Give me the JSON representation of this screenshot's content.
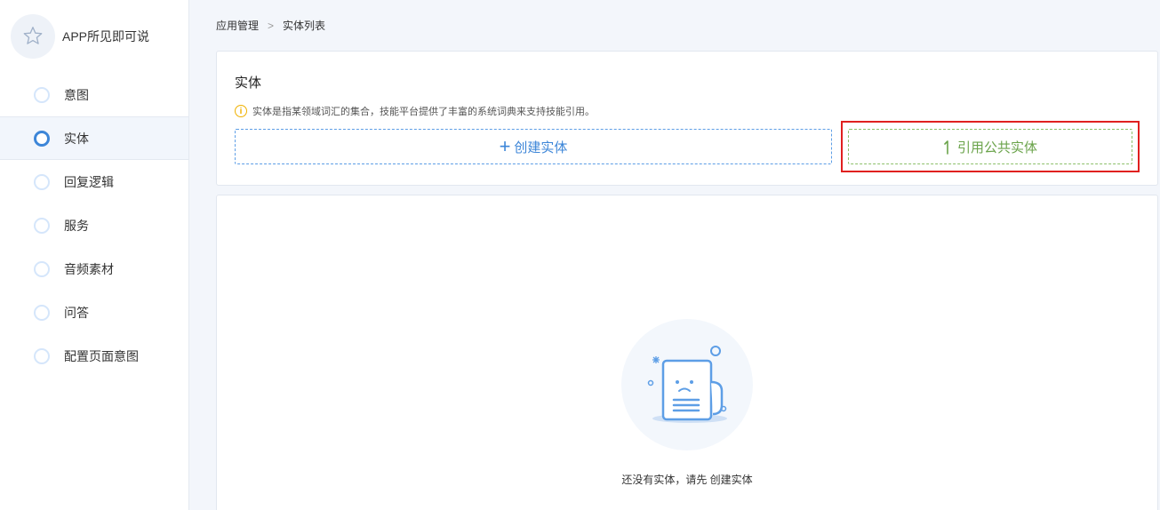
{
  "app": {
    "name": "APP所见即可说"
  },
  "sidebar": {
    "items": [
      {
        "label": "意图",
        "active": false
      },
      {
        "label": "实体",
        "active": true
      },
      {
        "label": "回复逻辑",
        "active": false
      },
      {
        "label": "服务",
        "active": false
      },
      {
        "label": "音频素材",
        "active": false
      },
      {
        "label": "问答",
        "active": false
      },
      {
        "label": "配置页面意图",
        "active": false
      }
    ]
  },
  "breadcrumb": {
    "parent": "应用管理",
    "separator": ">",
    "current": "实体列表"
  },
  "entity_panel": {
    "title": "实体",
    "tip_icon": "i",
    "tip": "实体是指某领域词汇的集合，技能平台提供了丰富的系统词典来支持技能引用。",
    "create_button": "创建实体",
    "reference_button": "引用公共实体"
  },
  "empty_state": {
    "text": "还没有实体，请先 创建实体"
  },
  "colors": {
    "accent": "#3d86d8",
    "reference_green": "#6aa34a",
    "highlight_red": "#e0201f",
    "tip_yellow": "#f0b100"
  }
}
